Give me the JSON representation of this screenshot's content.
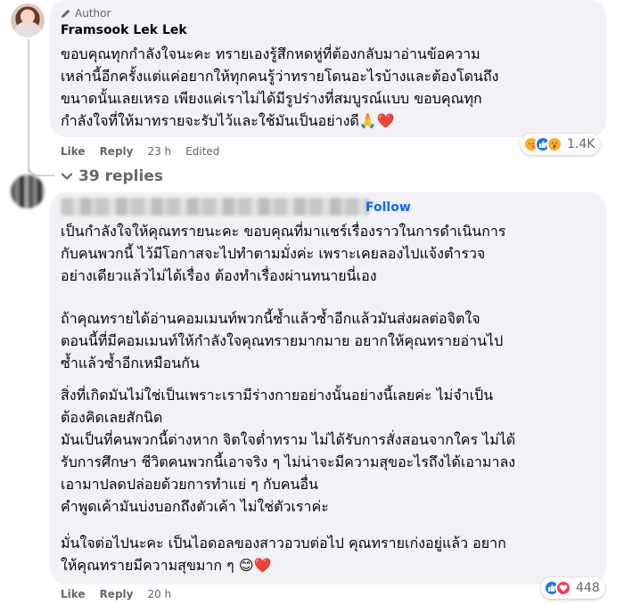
{
  "comment1": {
    "badge": "Author",
    "author": "Framsook Lek Lek",
    "text": "ขอบคุณทุกกำลังใจนะคะ ทรายเองรู้สึกหดหู่ที่ต้องกลับมาอ่านข้อความ\nเหล่านี้อีกครั้งแต่แค่อยากให้ทุกคนรู้ว่าทรายโดนอะไรบ้างและต้องโดนถึง\nขนาดนั้นเลยเหรอ เพียงแค่เราไม่ได้มีรูปร่างที่สมบูรณ์แบบ ขอบคุณทุก\nกำลังใจที่ให้มาทรายจะรับไว้และใช้มันเป็นอย่างดี🙏❤️",
    "like": "Like",
    "reply": "Reply",
    "time": "23 h",
    "edited": "Edited",
    "reaction_count": "1.4K",
    "reactions": [
      "hug-icon",
      "like-icon",
      "wow-icon"
    ]
  },
  "replies": {
    "label": "39 replies"
  },
  "comment2": {
    "follow": "Follow",
    "paragraphs": [
      "เป็นกำลังใจให้คุณทรายนะคะ ขอบคุณที่มาแชร์เรื่องราวในการดำเนินการ\nกับคนพวกนี้ ไว้มีโอกาสจะไปทำตามมั่งค่ะ เพราะเคยลองไปแจ้งตำรวจ\nอย่างเดียวแล้วไม่ได้เรื่อง ต้องทำเรื่องผ่านทนายนี่เอง",
      "ถ้าคุณทรายได้อ่านคอมเมนท์พวกนี้ซ้ำแล้วซ้ำอีกแล้วมันส่งผลต่อจิตใจ\nตอนนี้ที่มีคอมเมนท์ให้กำลังใจคุณทรายมากมาย อยากให้คุณทรายอ่านไป\nซ้ำแล้วซ้ำอีกเหมือนกัน",
      "สิ่งที่เกิดมันไม่ใช่เป็นเพราะเรามีร่างกายอย่างนั้นอย่างนี้เลยค่ะ ไม่จำเป็น\nต้องคิดเลยสักนิด\nมันเป็นที่คนพวกนี้ต่างหาก จิตใจต่ำทราม ไม่ได้รับการสั่งสอนจากใคร ไม่ได้\nรับการศึกษา ชีวิตคนพวกนี้เอาจริง ๆ ไม่น่าจะมีความสุขอะไรถึงได้เอามาลง\nเอามาปลดปล่อยด้วยการทำแย่ ๆ กับคนอื่น\nคำพูดเค้ามันบ่งบอกถึงตัวเค้า ไม่ใช่ตัวเราค่ะ",
      "มั่นใจต่อไปนะคะ เป็นไอดอลของสาวอวบต่อไป คุณทรายเก่งอยู่แล้ว อยาก\nให้คุณทรายมีความสุขมาก ๆ 😊❤️"
    ],
    "like": "Like",
    "reply": "Reply",
    "time": "20 h",
    "reaction_count": "448",
    "reactions": [
      "like-icon",
      "heart-icon"
    ]
  },
  "colors": {
    "bubble": "#f0f2f5",
    "link": "#0866ff",
    "secondary_text": "#65676b",
    "like_blue": "#1877f2",
    "heart_red": "#f33e58",
    "emoji_yellow": "#f7b125"
  }
}
